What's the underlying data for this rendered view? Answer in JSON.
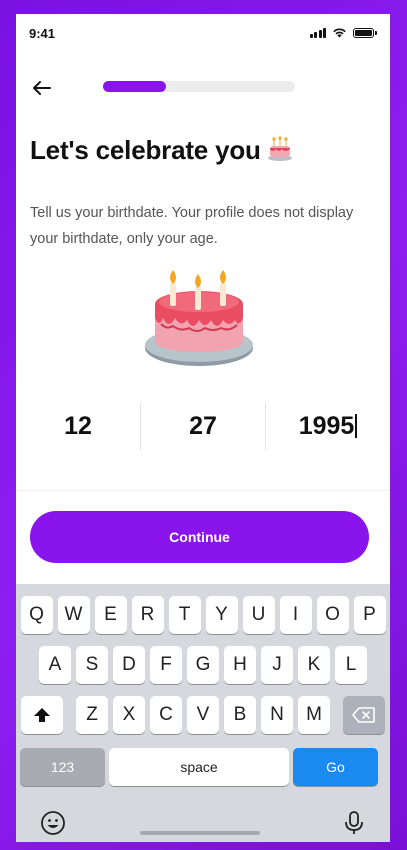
{
  "status": {
    "time": "9:41"
  },
  "header": {
    "progress": 0.33
  },
  "title": "Let's celebrate you",
  "subtitle": "Tell us your birthdate. Your profile does not display your birthdate, only your age.",
  "date": {
    "month": "12",
    "day": "27",
    "year": "1995"
  },
  "continue_label": "Continue",
  "keyboard": {
    "row1": [
      "Q",
      "W",
      "E",
      "R",
      "T",
      "Y",
      "U",
      "I",
      "O",
      "P"
    ],
    "row2": [
      "A",
      "S",
      "D",
      "F",
      "G",
      "H",
      "J",
      "K",
      "L"
    ],
    "row3": [
      "Z",
      "X",
      "C",
      "V",
      "B",
      "N",
      "M"
    ],
    "numbers_label": "123",
    "space_label": "space",
    "go_label": "Go"
  },
  "colors": {
    "accent": "#8a14ec",
    "go_key": "#1a8af0"
  },
  "icons": [
    "back-arrow-icon",
    "birthday-cake-icon",
    "shift-icon",
    "backspace-icon",
    "emoji-icon",
    "microphone-icon"
  ]
}
